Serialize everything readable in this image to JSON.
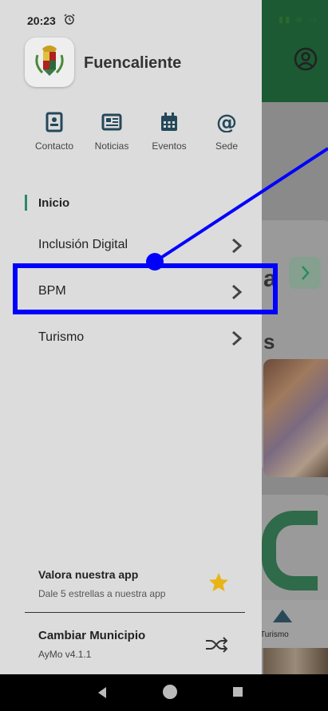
{
  "status_bar": {
    "time": "20:23",
    "alarm_icon": "alarm-icon",
    "right_icons": "▮▮ ≋ ▭"
  },
  "background_app": {
    "card_text_1": "a",
    "card_text_2": "s",
    "nav_label": "Turismo"
  },
  "drawer": {
    "app_name": "Fuencaliente",
    "quick_links": [
      {
        "label": "Contacto",
        "icon": "contact-card-icon"
      },
      {
        "label": "Noticias",
        "icon": "newspaper-icon"
      },
      {
        "label": "Eventos",
        "icon": "calendar-icon"
      },
      {
        "label": "Sede",
        "icon": "at-sign-icon"
      }
    ],
    "menu": [
      {
        "label": "Inicio",
        "active": true
      },
      {
        "label": "Inclusión Digital",
        "active": false
      },
      {
        "label": "BPM",
        "active": false
      },
      {
        "label": "Turismo",
        "active": false
      }
    ],
    "rate": {
      "title": "Valora nuestra app",
      "subtitle": "Dale 5 estrellas a nuestra app"
    },
    "change": {
      "title": "Cambiar Municipio",
      "version": "AyMo v4.1.1"
    }
  },
  "colors": {
    "accent": "#2a8a66",
    "annotation": "#0000ff",
    "star": "#e8b417",
    "header": "#1b5a33"
  }
}
